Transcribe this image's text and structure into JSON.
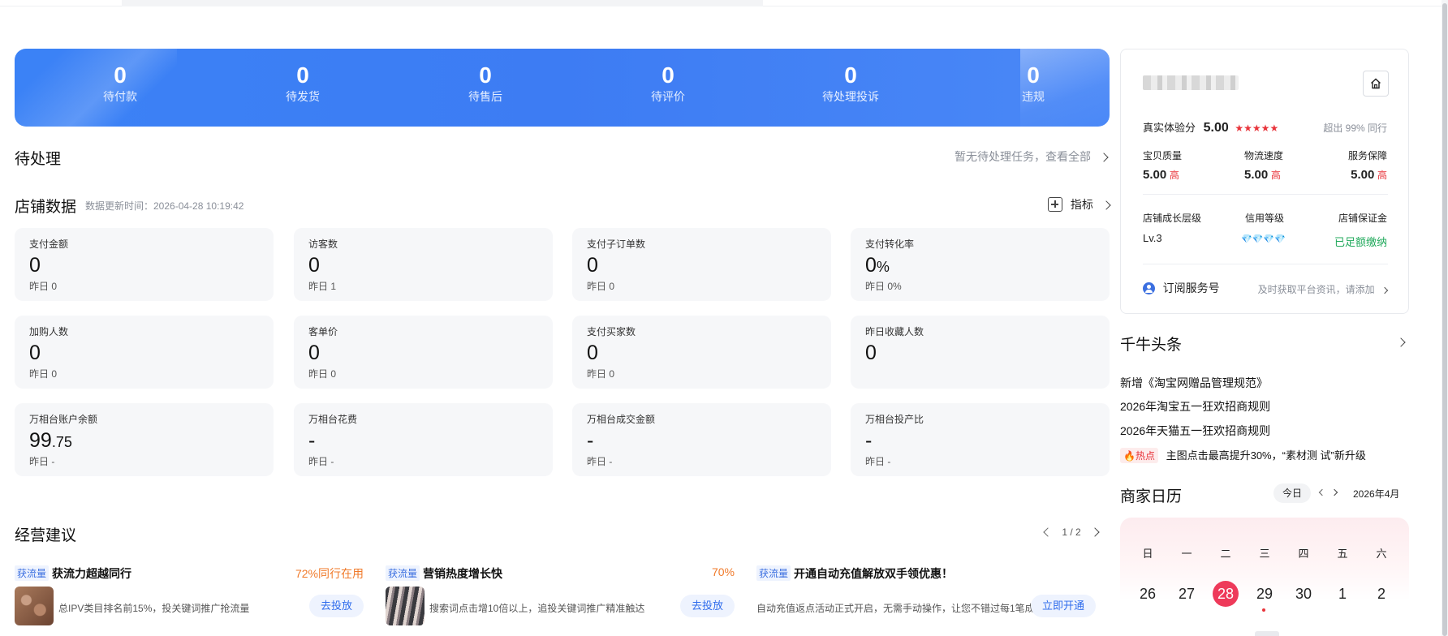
{
  "orders": [
    {
      "value": "0",
      "label": "待付款"
    },
    {
      "value": "0",
      "label": "待发货"
    },
    {
      "value": "0",
      "label": "待售后"
    },
    {
      "value": "0",
      "label": "待评价"
    },
    {
      "value": "0",
      "label": "待处理投诉"
    },
    {
      "value": "0",
      "label": "违规"
    }
  ],
  "pending": {
    "title": "待处理",
    "note": "暂无待处理任务，查看全部"
  },
  "shop_data": {
    "title": "店铺数据",
    "update_time": "数据更新时间：2026-04-28 10:19:42",
    "metric_link": "指标",
    "cards": [
      {
        "label": "支付金额",
        "value": "0",
        "unit": "",
        "yesterday": "昨日 0"
      },
      {
        "label": "访客数",
        "value": "0",
        "unit": "",
        "yesterday": "昨日 1"
      },
      {
        "label": "支付子订单数",
        "value": "0",
        "unit": "",
        "yesterday": "昨日 0"
      },
      {
        "label": "支付转化率",
        "value": "0",
        "unit": "%",
        "yesterday": "昨日 0%"
      },
      {
        "label": "加购人数",
        "value": "0",
        "unit": "",
        "yesterday": "昨日 0"
      },
      {
        "label": "客单价",
        "value": "0",
        "unit": "",
        "yesterday": "昨日 0"
      },
      {
        "label": "支付买家数",
        "value": "0",
        "unit": "",
        "yesterday": "昨日 0"
      },
      {
        "label": "昨日收藏人数",
        "value": "0",
        "unit": "",
        "yesterday": ""
      },
      {
        "label": "万相台账户余额",
        "value": "99",
        "unit": ".75",
        "yesterday": "昨日 -"
      },
      {
        "label": "万相台花费",
        "value": "-",
        "unit": "",
        "yesterday": "昨日 -"
      },
      {
        "label": "万相台成交金额",
        "value": "-",
        "unit": "",
        "yesterday": "昨日 -"
      },
      {
        "label": "万相台投产比",
        "value": "-",
        "unit": "",
        "yesterday": "昨日 -"
      }
    ]
  },
  "advice": {
    "title": "经营建议",
    "pager": "1 / 2",
    "items": [
      {
        "tag": "获流量",
        "title": "获流力超越同行",
        "percent": "72%同行在用",
        "desc": "总IPV类目排名前15%，投关键词推广抢流量",
        "button": "去投放"
      },
      {
        "tag": "获流量",
        "title": "营销热度增长快",
        "percent": "70%",
        "desc": "搜索词点击增10倍以上，追投关键词推广精准触达",
        "button": "去投放"
      },
      {
        "tag": "获流量",
        "title": "开通自动充值解放双手领优惠！",
        "percent": "",
        "desc": "自动充值返点活动正式开启，无需手动操作，让您不错过每1笔成",
        "button": "立即开通"
      }
    ]
  },
  "shop_card": {
    "score_label": "真实体验分",
    "score": "5.00",
    "stars": "★★★★★",
    "beyond": "超出 99% 同行",
    "sub_scores": [
      {
        "label": "宝贝质量",
        "value": "5.00",
        "level": "高"
      },
      {
        "label": "物流速度",
        "value": "5.00",
        "level": "高"
      },
      {
        "label": "服务保障",
        "value": "5.00",
        "level": "高"
      }
    ],
    "growth_label": "店铺成长层级",
    "growth_value": "Lv.3",
    "credit_label": "信用等级",
    "credit_value": "💎💎💎💎",
    "deposit_label": "店铺保证金",
    "deposit_value": "已足额缴纳",
    "subscribe_label": "订阅服务号",
    "subscribe_note": "及时获取平台资讯，请添加"
  },
  "news": {
    "title": "千牛头条",
    "items": [
      "新增《淘宝网赠品管理规范》",
      "2026年淘宝五一狂欢招商规则",
      "2026年天猫五一狂欢招商规则"
    ],
    "hot_tag": "热点",
    "hot_item": "主图点击最高提升30%，“素材测 试”新升级"
  },
  "calendar": {
    "title": "商家日历",
    "today": "今日",
    "month": "2026年4月",
    "weekdays": [
      "日",
      "一",
      "二",
      "三",
      "四",
      "五",
      "六"
    ],
    "days": [
      "26",
      "27",
      "28",
      "29",
      "30",
      "1",
      "2"
    ],
    "selected": "28"
  },
  "colors": {
    "brand_blue": "#3b82f6",
    "accent_red": "#e8343b",
    "highlight": "#ee3a5a",
    "green": "#20a95b"
  }
}
